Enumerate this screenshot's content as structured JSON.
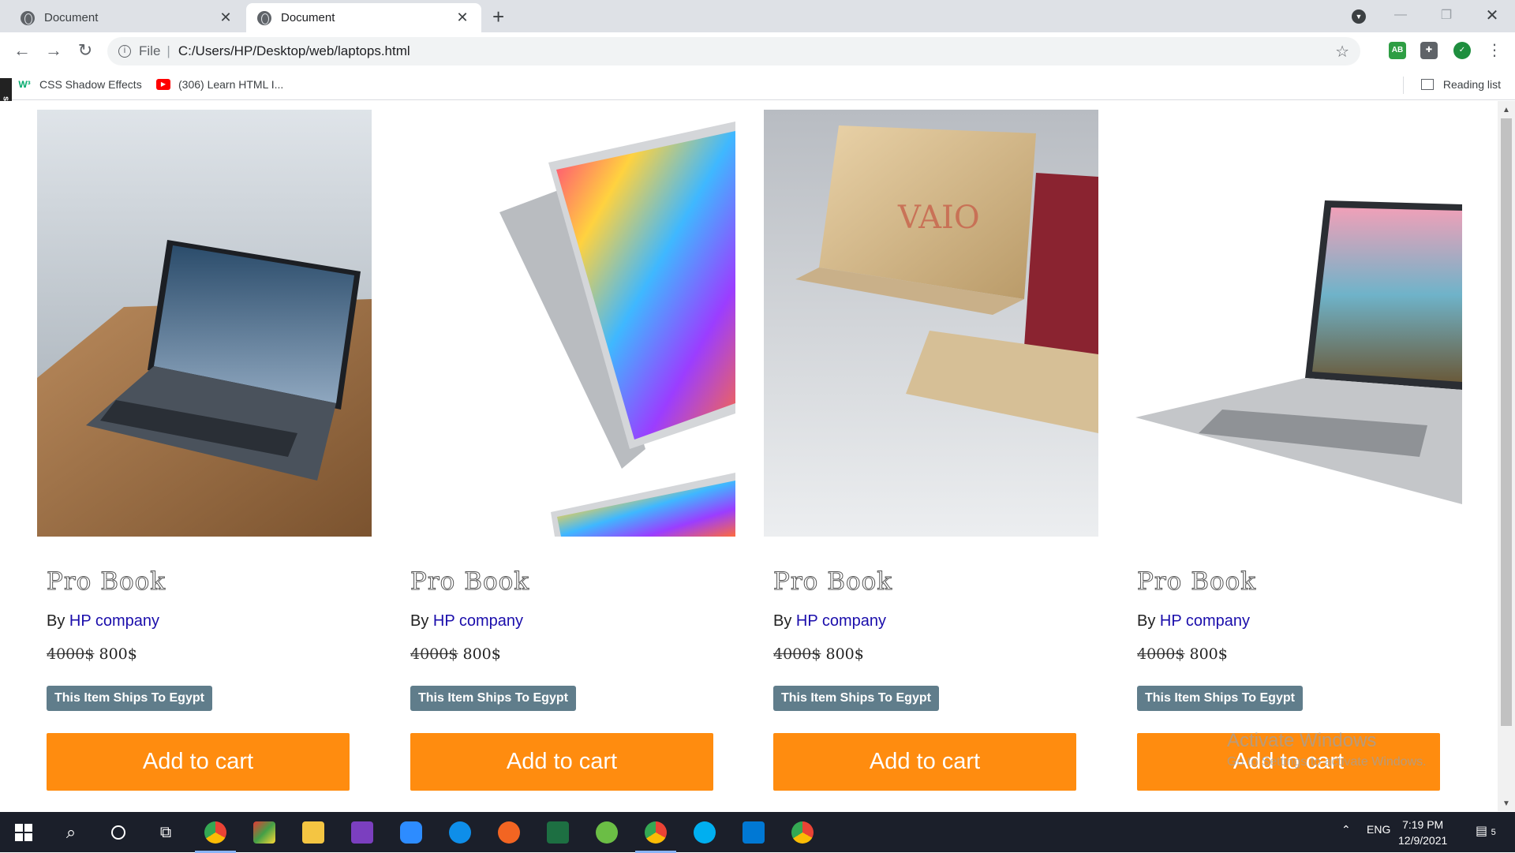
{
  "browser": {
    "tabs": [
      {
        "title": "Document",
        "active": false
      },
      {
        "title": "Document",
        "active": true
      }
    ],
    "address": {
      "scheme": "File",
      "path": "C:/Users/HP/Desktop/web/laptops.html"
    },
    "bookmarks": [
      {
        "label": "CSS Shadow Effects",
        "icon": "w3schools-icon"
      },
      {
        "label": "(306) Learn HTML I...",
        "icon": "youtube-icon"
      }
    ],
    "reading_list": "Reading list",
    "screenrec_label": "screenrec"
  },
  "products": [
    {
      "name": "Pro Book",
      "by": "By",
      "company": "HP company",
      "old_price": "4000$",
      "price": "800$",
      "ships": "This Item Ships To Egypt",
      "cart": "Add to cart",
      "image": "macbook-on-wood-table"
    },
    {
      "name": "Pro Book",
      "by": "By",
      "company": "HP company",
      "old_price": "4000$",
      "price": "800$",
      "ships": "This Item Ships To Egypt",
      "cart": "Add to cart",
      "image": "convertible-laptop-swirl-screen"
    },
    {
      "name": "Pro Book",
      "by": "By",
      "company": "HP company",
      "old_price": "4000$",
      "price": "800$",
      "ships": "This Item Ships To Egypt",
      "cart": "Add to cart",
      "image": "vaio-gold-laptops"
    },
    {
      "name": "Pro Book",
      "by": "By",
      "company": "HP company",
      "old_price": "4000$",
      "price": "800$",
      "ships": "This Item Ships To Egypt",
      "cart": "Add to cart",
      "image": "silver-lenovo-laptop"
    }
  ],
  "watermark": {
    "line1": "Activate Windows",
    "line2": "Go to Settings to activate Windows."
  },
  "taskbar": {
    "lang": "ENG",
    "time": "7:19 PM",
    "date": "12/9/2021",
    "notifications": "5"
  },
  "colors": {
    "cart": "#ff8c0f",
    "ships": "#607d8b",
    "link": "#1a0dab"
  }
}
